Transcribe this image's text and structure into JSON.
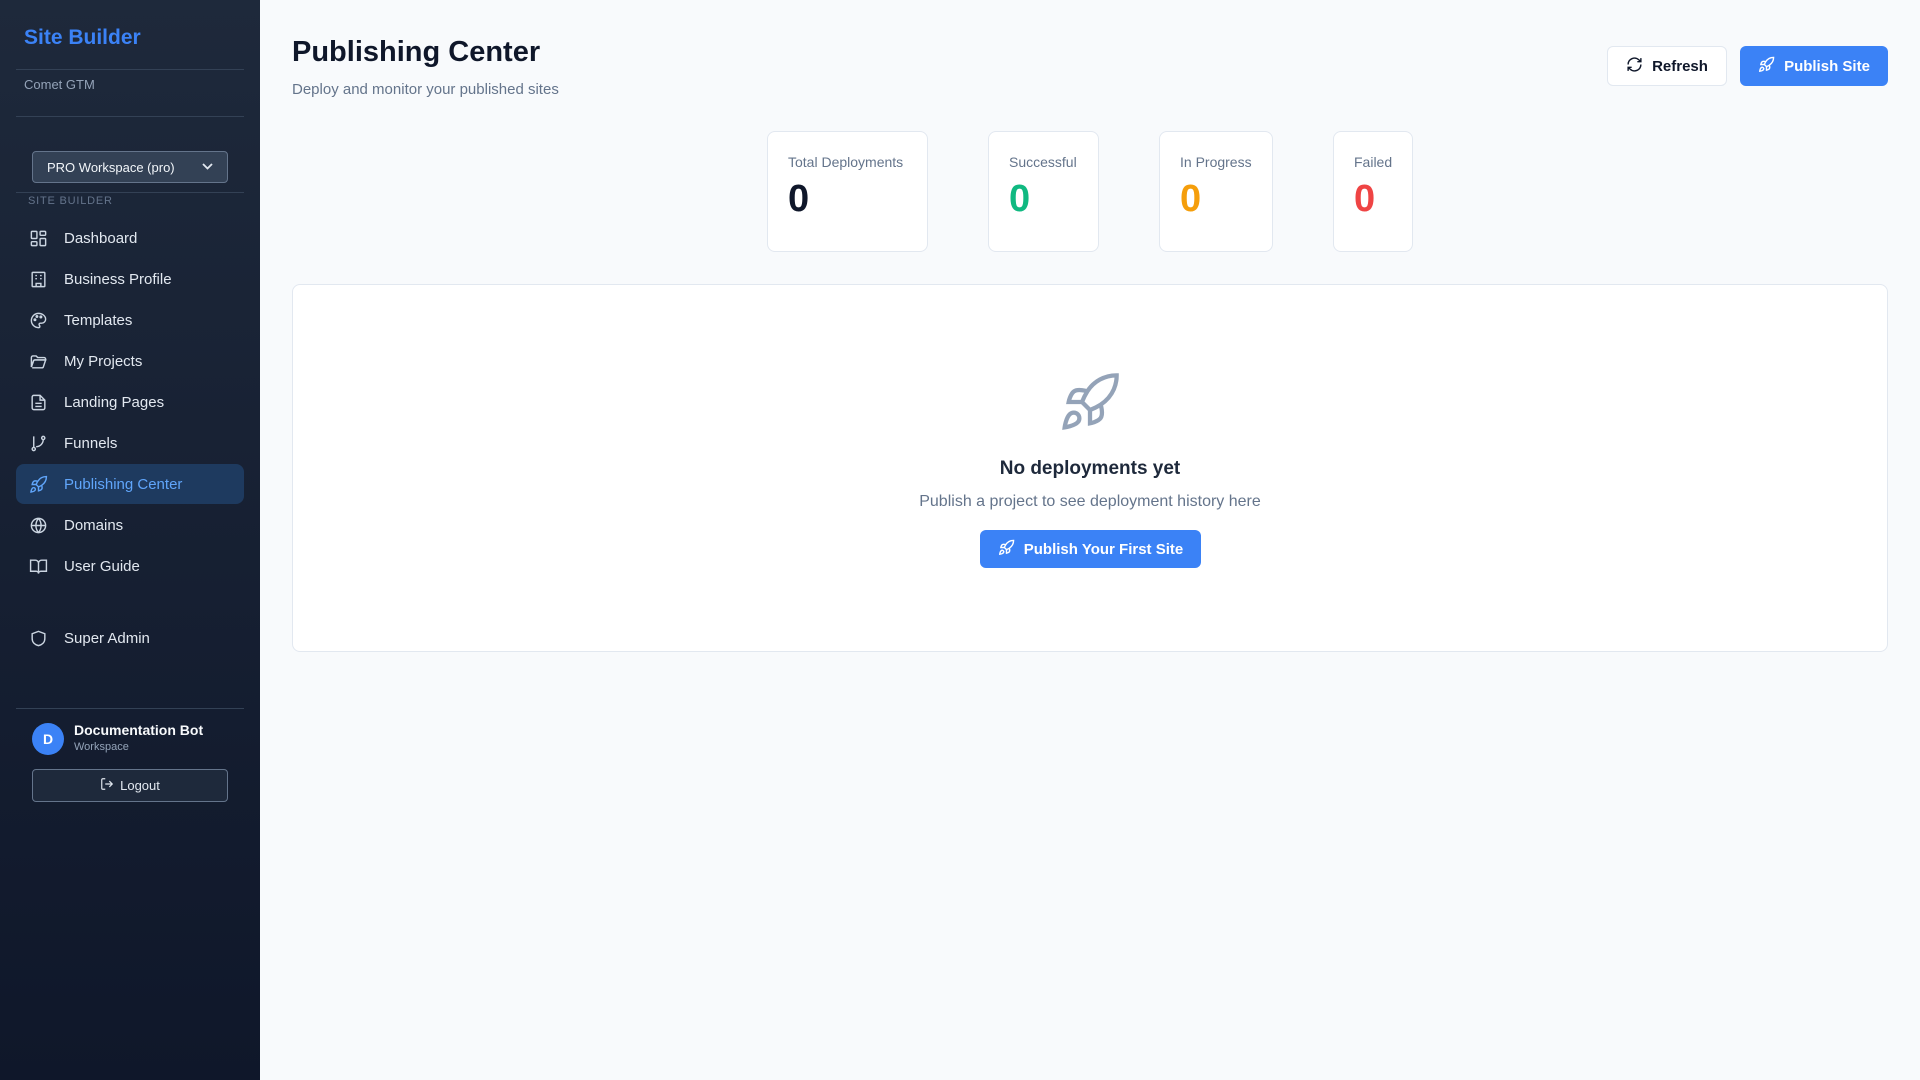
{
  "sidebar": {
    "brand": "Site Builder",
    "org": "Comet GTM",
    "workspace_select": "PRO Workspace (pro)",
    "section_label": "SITE BUILDER",
    "items": [
      {
        "label": "Dashboard",
        "icon": "dashboard-icon"
      },
      {
        "label": "Business Profile",
        "icon": "building-icon"
      },
      {
        "label": "Templates",
        "icon": "palette-icon"
      },
      {
        "label": "My Projects",
        "icon": "folder-icon"
      },
      {
        "label": "Landing Pages",
        "icon": "file-icon"
      },
      {
        "label": "Funnels",
        "icon": "git-branch-icon"
      },
      {
        "label": "Publishing Center",
        "icon": "rocket-icon",
        "active": true
      },
      {
        "label": "Domains",
        "icon": "globe-icon"
      },
      {
        "label": "User Guide",
        "icon": "book-icon"
      }
    ],
    "admin": {
      "label": "Super Admin",
      "icon": "shield-icon"
    },
    "user": {
      "initial": "D",
      "name": "Documentation Bot",
      "role": "Workspace"
    },
    "logout_label": "Logout"
  },
  "header": {
    "title": "Publishing Center",
    "subtitle": "Deploy and monitor your published sites",
    "refresh_label": "Refresh",
    "publish_label": "Publish Site"
  },
  "stats": [
    {
      "label": "Total Deployments",
      "value": "0",
      "color": "#0f172a"
    },
    {
      "label": "Successful",
      "value": "0",
      "color": "#10b981"
    },
    {
      "label": "In Progress",
      "value": "0",
      "color": "#f59e0b"
    },
    {
      "label": "Failed",
      "value": "0",
      "color": "#ef4444"
    }
  ],
  "empty_state": {
    "title": "No deployments yet",
    "subtitle": "Publish a project to see deployment history here",
    "button_label": "Publish Your First Site"
  },
  "colors": {
    "accent": "#3b82f6",
    "sidebar_bg": "#1e293b",
    "active_item_bg": "#1e3a5f"
  }
}
